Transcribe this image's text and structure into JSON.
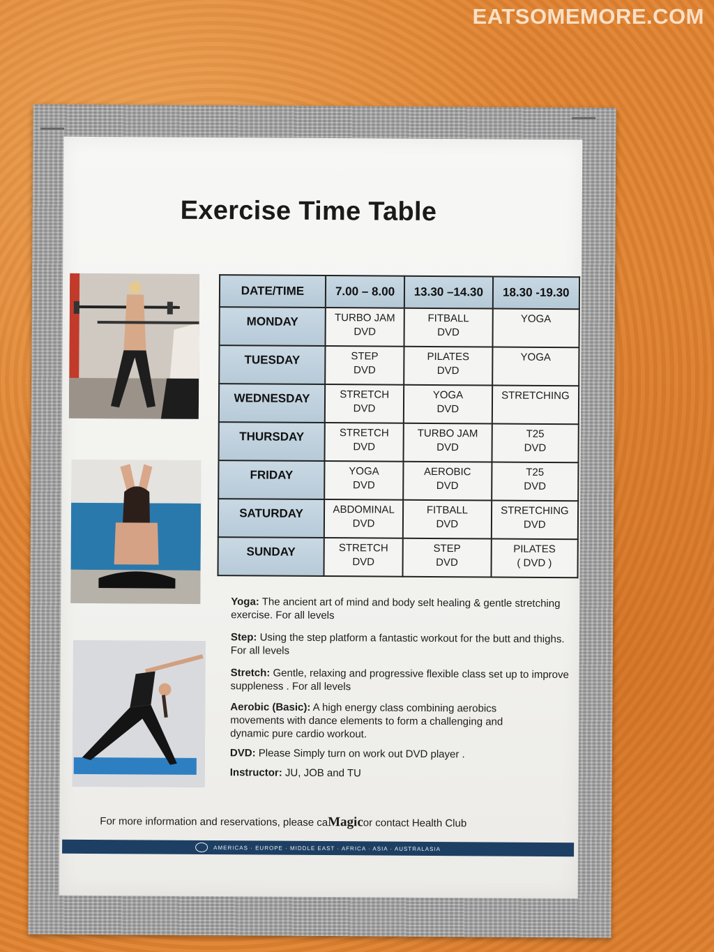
{
  "watermark": "EATSOMEMORE.COM",
  "title": "Exercise Time Table",
  "table": {
    "header": [
      "DATE/TIME",
      "7.00 – 8.00",
      "13.30 –14.30",
      "18.30 -19.30"
    ],
    "rows": [
      {
        "day": "MONDAY",
        "c1": [
          "TURBO JAM",
          "DVD"
        ],
        "c2": [
          "FITBALL",
          "DVD"
        ],
        "c3": [
          "YOGA",
          ""
        ]
      },
      {
        "day": "TUESDAY",
        "c1": [
          "STEP",
          "DVD"
        ],
        "c2": [
          "PILATES",
          "DVD"
        ],
        "c3": [
          "YOGA",
          ""
        ]
      },
      {
        "day": "WEDNESDAY",
        "c1": [
          "STRETCH",
          "DVD"
        ],
        "c2": [
          "YOGA",
          "DVD"
        ],
        "c3": [
          "STRETCHING",
          ""
        ]
      },
      {
        "day": "THURSDAY",
        "c1": [
          "STRETCH",
          "DVD"
        ],
        "c2": [
          "TURBO JAM",
          "DVD"
        ],
        "c3": [
          "T25",
          "DVD"
        ]
      },
      {
        "day": "FRIDAY",
        "c1": [
          "YOGA",
          "DVD"
        ],
        "c2": [
          "AEROBIC",
          "DVD"
        ],
        "c3": [
          "T25",
          "DVD"
        ]
      },
      {
        "day": "SATURDAY",
        "c1": [
          "ABDOMINAL",
          "DVD"
        ],
        "c2": [
          "FITBALL",
          "DVD"
        ],
        "c3": [
          "STRETCHING",
          "DVD"
        ]
      },
      {
        "day": "SUNDAY",
        "c1": [
          "STRETCH",
          "DVD"
        ],
        "c2": [
          "STEP",
          "DVD"
        ],
        "c3": [
          "PILATES",
          "( DVD )"
        ]
      }
    ]
  },
  "descriptions": [
    {
      "term": "Yoga:",
      "text": " The ancient art of mind and body selt healing & gentle stretching exercise. For all levels"
    },
    {
      "term": "Step:",
      "text": "  Using the step platform a fantastic workout for the butt and thighs. For all levels"
    },
    {
      "term": "Stretch:",
      "text": " Gentle, relaxing and progressive flexible class set up to improve suppleness . For all levels"
    },
    {
      "term": "Aerobic (Basic):",
      "text": " A high energy class combining aerobics movements with dance elements to form a challenging and dynamic pure cardio workout."
    },
    {
      "term": "DVD:",
      "text": " Please Simply turn on work out DVD player ."
    },
    {
      "term": "Instructor:",
      "text": " JU, JOB and TU"
    }
  ],
  "footer": {
    "before": "For more information and reservations, please ca",
    "magic": "Magic",
    "after": "or contact Health Club"
  },
  "band": "AMERICAS · EUROPE · MIDDLE EAST · AFRICA · ASIA · AUSTRALASIA",
  "colors": {
    "background": "#e0822f",
    "tape": "#a9a9a9",
    "paper": "#f4f4f2",
    "header_cell": "#c7d8e3",
    "band": "#1d3f63"
  }
}
